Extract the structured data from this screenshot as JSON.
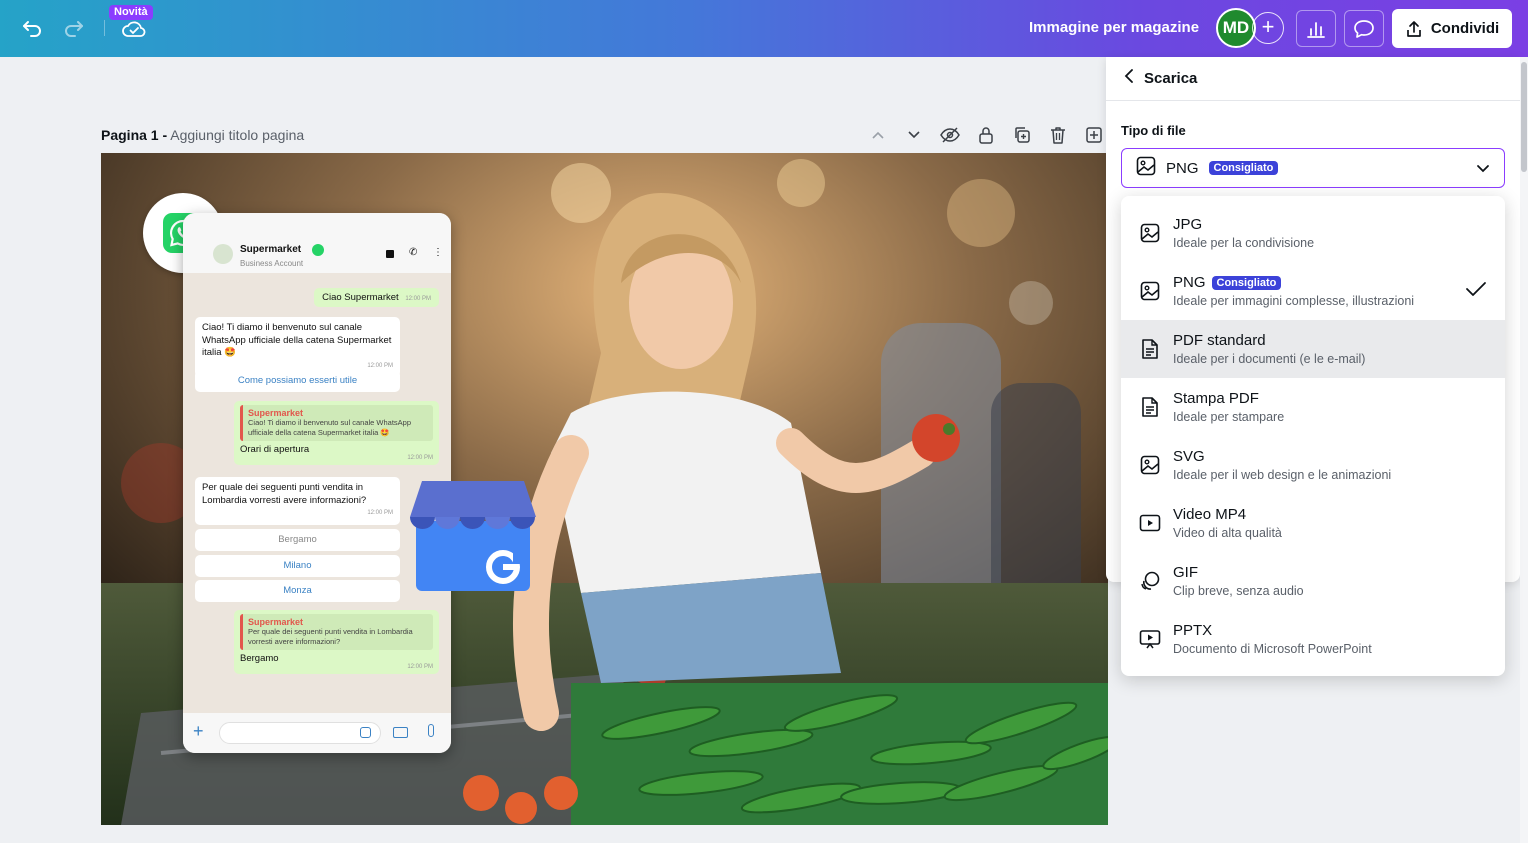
{
  "topbar": {
    "badge_new": "Novità",
    "document_title": "Immagine per magazine",
    "avatar_initials": "MD",
    "share_label": "Condividi"
  },
  "page": {
    "number_label": "Pagina 1 -",
    "title_placeholder": "Aggiungi titolo pagina"
  },
  "chat": {
    "contact_name": "Supermarket",
    "contact_sub": "Business Account",
    "msg1": "Ciao Supermarket",
    "msg1_time": "12:00 PM",
    "msg2": "Ciao! Ti diamo il benvenuto sul canale WhatsApp ufficiale della catena Supermarket italia 🤩",
    "msg2_time": "12:00 PM",
    "msg2_action": "Come possiamo esserti utile",
    "quote1_sender": "Supermarket",
    "quote1_text": "Ciao! Ti diamo il benvenuto sul canale WhatsApp ufficiale della catena Supermarket italia 🤩",
    "reply1": "Orari di apertura",
    "reply1_time": "12:00 PM",
    "msg3": "Per quale dei seguenti punti vendita in Lombardia vorresti avere informazioni?",
    "msg3_time": "12:00 PM",
    "options": [
      "Bergamo",
      "Milano",
      "Monza"
    ],
    "quote2_sender": "Supermarket",
    "quote2_text": "Per quale dei seguenti punti vendita in Lombardia vorresti avere informazioni?",
    "reply2": "Bergamo",
    "reply2_time": "12:00 PM"
  },
  "panel": {
    "title": "Scarica",
    "file_type_label": "Tipo di file",
    "selected_type": "PNG",
    "selected_badge": "Consigliato"
  },
  "file_types": [
    {
      "name": "JPG",
      "desc": "Ideale per la condivisione",
      "icon": "image-icon"
    },
    {
      "name": "PNG",
      "badge": "Consigliato",
      "desc": "Ideale per immagini complesse, illustrazioni",
      "icon": "image-icon"
    },
    {
      "name": "PDF standard",
      "desc": "Ideale per i documenti (e le e-mail)",
      "icon": "document-icon"
    },
    {
      "name": "Stampa PDF",
      "desc": "Ideale per stampare",
      "icon": "document-icon"
    },
    {
      "name": "SVG",
      "desc": "Ideale per il web design e le animazioni",
      "icon": "image-icon"
    },
    {
      "name": "Video MP4",
      "desc": "Video di alta qualità",
      "icon": "video-icon"
    },
    {
      "name": "GIF",
      "desc": "Clip breve, senza audio",
      "icon": "gif-icon"
    },
    {
      "name": "PPTX",
      "desc": "Documento di Microsoft PowerPoint",
      "icon": "presentation-icon"
    }
  ],
  "colors": {
    "accent": "#8b3dff",
    "badge_blue": "#3c42d9",
    "whatsapp_green": "#25d366"
  }
}
